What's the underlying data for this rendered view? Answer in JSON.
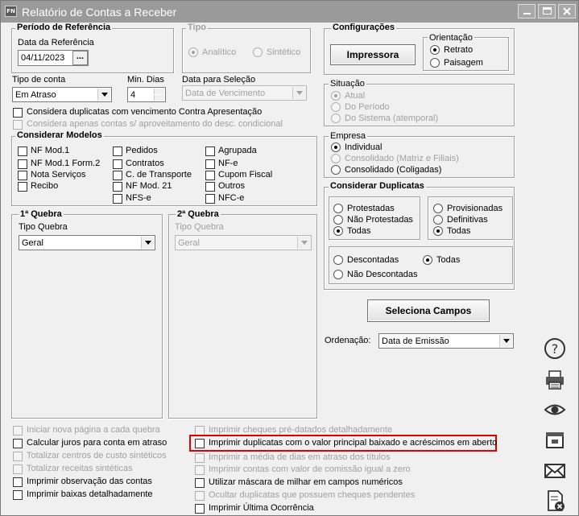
{
  "window": {
    "title": "Relatório de Contas a Receber",
    "app_badge": "FN"
  },
  "periodo": {
    "legend": "Período de Referência",
    "data_label": "Data da Referência",
    "data_value": "04/11/2023",
    "btn": "..."
  },
  "tipo": {
    "legend": "Tipo",
    "analitico": "Analítico",
    "sintetico": "Sintético"
  },
  "configuracoes": {
    "legend": "Configurações",
    "impressora": "Impressora",
    "orientacao": "Orientação",
    "retrato": "Retrato",
    "paisagem": "Paisagem"
  },
  "tipo_conta": {
    "label": "Tipo de conta",
    "value": "Em Atraso"
  },
  "min_dias": {
    "label": "Min. Dias",
    "value": "4"
  },
  "data_selecao": {
    "label": "Data para Seleção",
    "value": "Data de Vencimento"
  },
  "checks_top": {
    "apresentacao": "Considera duplicatas com vencimento Contra Apresentação",
    "aproveitamento": "Considera apenas contas s/ aproveitamento do desc. condicional"
  },
  "modelos": {
    "legend": "Considerar Modelos",
    "col1": [
      "NF Mod.1",
      "NF Mod.1 Form.2",
      "Nota Serviços",
      "Recibo"
    ],
    "col2": [
      "Pedidos",
      "Contratos",
      "C. de Transporte",
      "NF Mod. 21",
      "NFS-e"
    ],
    "col3": [
      "Agrupada",
      "NF-e",
      "Cupom Fiscal",
      "Outros",
      "NFC-e"
    ]
  },
  "situacao": {
    "legend": "Situação",
    "atual": "Atual",
    "periodo": "Do Período",
    "sistema": "Do Sistema (atemporal)"
  },
  "empresa": {
    "legend": "Empresa",
    "individual": "Individual",
    "consolidado": "Consolidado (Matriz e Filiais)",
    "coligadas": "Consolidado (Coligadas)"
  },
  "duplicatas": {
    "legend": "Considerar Duplicatas",
    "protestadas": "Protestadas",
    "nao_protestadas": "Não Protestadas",
    "todas1": "Todas",
    "provisionadas": "Provisionadas",
    "definitivas": "Definitivas",
    "todas2": "Todas",
    "descontadas": "Descontadas",
    "todas3": "Todas",
    "nao_descontadas": "Não Descontadas"
  },
  "quebra1": {
    "legend": "1ª Quebra",
    "label": "Tipo Quebra",
    "value": "Geral"
  },
  "quebra2": {
    "legend": "2ª Quebra",
    "label": "Tipo Quebra",
    "value": "Geral"
  },
  "seleciona_campos": "Seleciona Campos",
  "ordenacao": {
    "label": "Ordenação:",
    "value": "Data de Emissão"
  },
  "bottom_left": [
    "Iniciar nova página a cada quebra",
    "Calcular juros para conta em atraso",
    "Totalizar centros de custo sintéticos",
    "Totalizar receitas sintéticas",
    "Imprimir observação das contas",
    "Imprimir baixas detalhadamente"
  ],
  "bottom_right": [
    "Imprimir cheques pré-datados detalhadamente",
    "Imprimir duplicatas com o valor principal baixado e acréscimos em aberto",
    "Imprimir a média de dias em atraso dos títulos",
    "Imprimir contas com valor de comissão igual a zero",
    "Utilizar máscara de milhar em campos numéricos",
    "Ocultar duplicatas que possuem cheques pendentes",
    "Imprimir Última Ocorrência"
  ],
  "colors": {
    "title_bar": "#9a9a9a",
    "highlight": "#e00000"
  }
}
